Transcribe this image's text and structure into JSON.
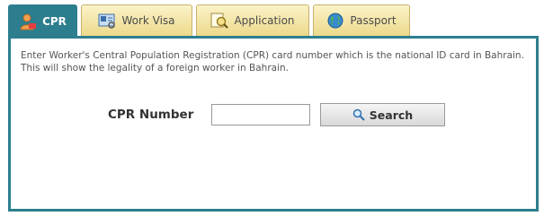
{
  "tabs": [
    {
      "label": "CPR",
      "icon": "person-icon",
      "active": true
    },
    {
      "label": "Work Visa",
      "icon": "work-visa-icon",
      "active": false
    },
    {
      "label": "Application",
      "icon": "application-search-icon",
      "active": false
    },
    {
      "label": "Passport",
      "icon": "globe-icon",
      "active": false
    }
  ],
  "panel": {
    "description": "Enter Worker's Central Population Registration (CPR) card number which is the national ID card in Bahrain. This will show the legality of a foreign worker in Bahrain.",
    "cpr_label": "CPR Number",
    "cpr_value": "",
    "search_label": "Search"
  },
  "colors": {
    "accent": "#2c7e8e",
    "tab_bg": "#f3e3a4"
  }
}
